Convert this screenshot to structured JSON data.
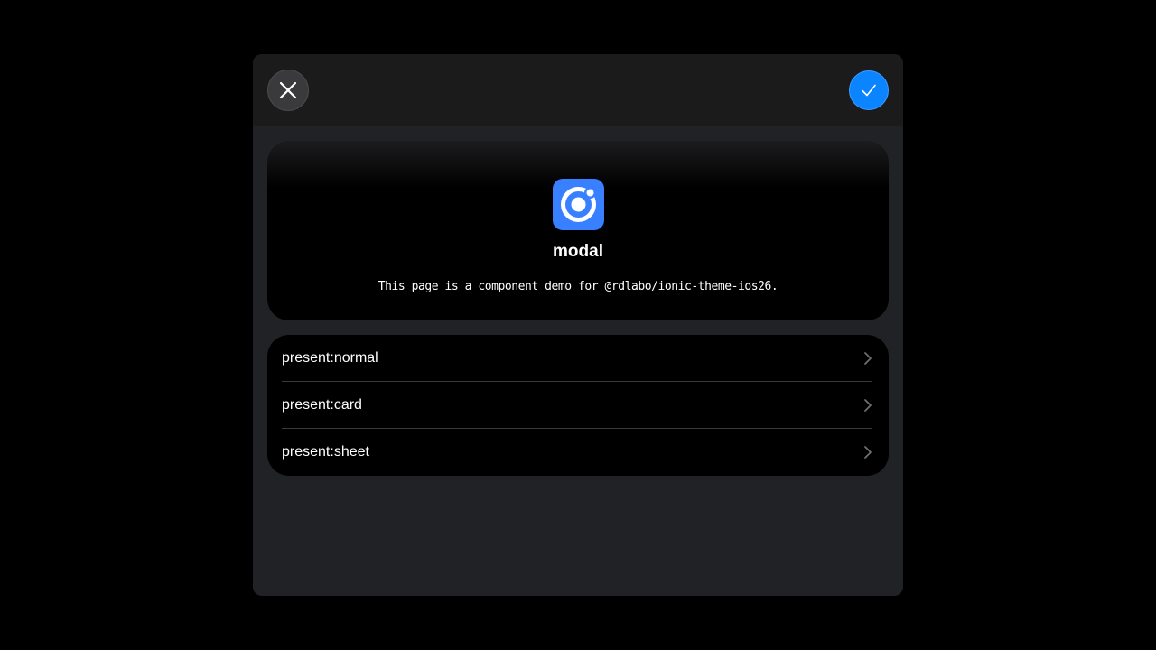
{
  "header": {
    "close_icon": "close-icon",
    "confirm_icon": "checkmark-icon",
    "accent_color": "#0a84ff"
  },
  "hero": {
    "logo_icon": "ionic-logo-icon",
    "title": "modal",
    "description": "This page is a component demo for @rdlabo/ionic-theme-ios26."
  },
  "list": {
    "items": [
      {
        "label": "present:normal",
        "icon": "chevron-right-icon"
      },
      {
        "label": "present:card",
        "icon": "chevron-right-icon"
      },
      {
        "label": "present:sheet",
        "icon": "chevron-right-icon"
      }
    ]
  }
}
